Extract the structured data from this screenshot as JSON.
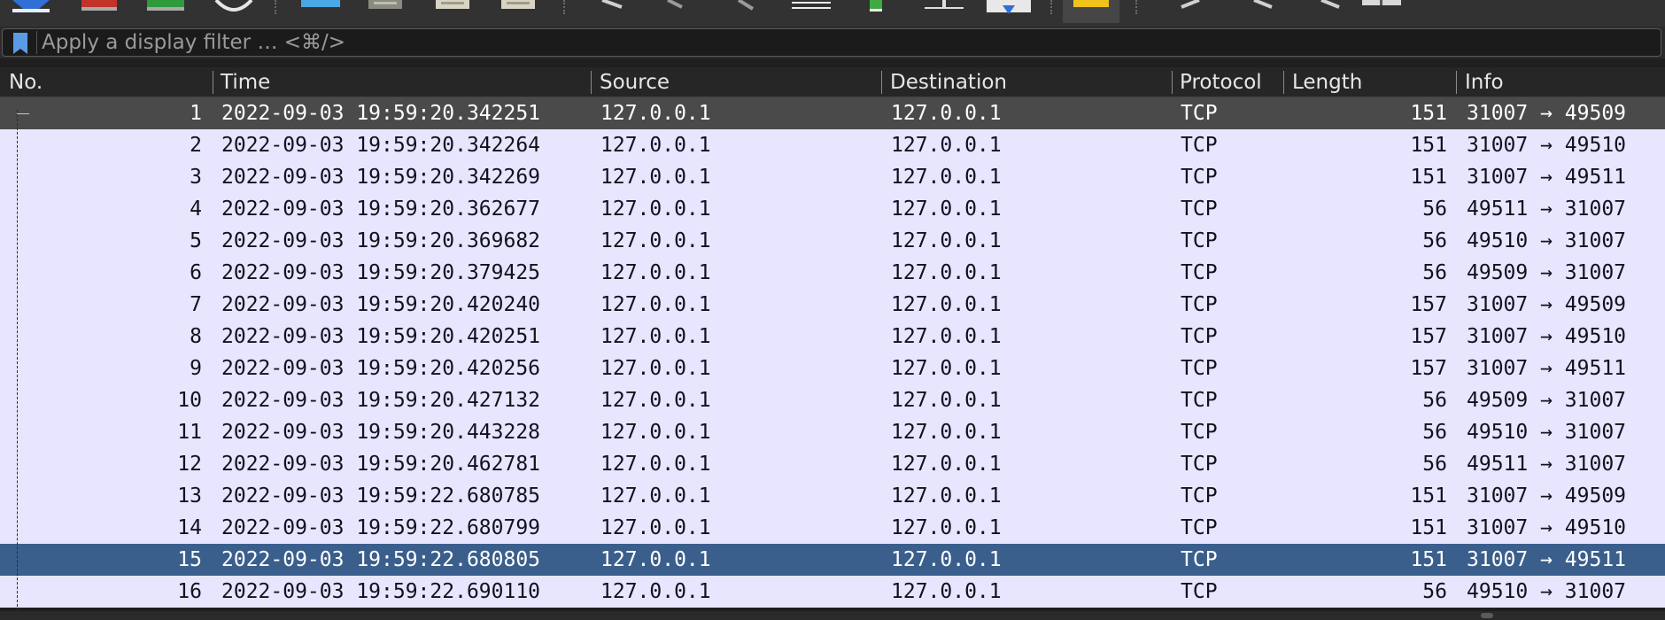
{
  "toolbar": {
    "icons": [
      "start-capture-icon",
      "stop-capture-icon",
      "restart-capture-icon",
      "capture-options-icon",
      "open-file-icon",
      "save-file-icon",
      "close-file-icon",
      "reload-file-icon",
      "find-packet-icon",
      "go-back-icon",
      "go-forward-icon",
      "go-to-packet-icon",
      "go-to-first-packet-icon",
      "go-to-last-packet-icon",
      "auto-scroll-icon",
      "colorize-icon",
      "zoom-in-icon",
      "zoom-out-icon",
      "normal-size-icon",
      "resize-columns-icon"
    ]
  },
  "filter": {
    "placeholder": "Apply a display filter … <⌘/>",
    "value": ""
  },
  "packet_list": {
    "columns": [
      "No.",
      "Time",
      "Source",
      "Destination",
      "Protocol",
      "Length",
      "Info"
    ],
    "rows": [
      {
        "no": "1",
        "time": "2022-09-03 19:59:20.342251",
        "source": "127.0.0.1",
        "destination": "127.0.0.1",
        "protocol": "TCP",
        "length": "151",
        "info": "31007 → 49509"
      },
      {
        "no": "2",
        "time": "2022-09-03 19:59:20.342264",
        "source": "127.0.0.1",
        "destination": "127.0.0.1",
        "protocol": "TCP",
        "length": "151",
        "info": "31007 → 49510"
      },
      {
        "no": "3",
        "time": "2022-09-03 19:59:20.342269",
        "source": "127.0.0.1",
        "destination": "127.0.0.1",
        "protocol": "TCP",
        "length": "151",
        "info": "31007 → 49511"
      },
      {
        "no": "4",
        "time": "2022-09-03 19:59:20.362677",
        "source": "127.0.0.1",
        "destination": "127.0.0.1",
        "protocol": "TCP",
        "length": "56",
        "info": "49511 → 31007"
      },
      {
        "no": "5",
        "time": "2022-09-03 19:59:20.369682",
        "source": "127.0.0.1",
        "destination": "127.0.0.1",
        "protocol": "TCP",
        "length": "56",
        "info": "49510 → 31007"
      },
      {
        "no": "6",
        "time": "2022-09-03 19:59:20.379425",
        "source": "127.0.0.1",
        "destination": "127.0.0.1",
        "protocol": "TCP",
        "length": "56",
        "info": "49509 → 31007"
      },
      {
        "no": "7",
        "time": "2022-09-03 19:59:20.420240",
        "source": "127.0.0.1",
        "destination": "127.0.0.1",
        "protocol": "TCP",
        "length": "157",
        "info": "31007 → 49509"
      },
      {
        "no": "8",
        "time": "2022-09-03 19:59:20.420251",
        "source": "127.0.0.1",
        "destination": "127.0.0.1",
        "protocol": "TCP",
        "length": "157",
        "info": "31007 → 49510"
      },
      {
        "no": "9",
        "time": "2022-09-03 19:59:20.420256",
        "source": "127.0.0.1",
        "destination": "127.0.0.1",
        "protocol": "TCP",
        "length": "157",
        "info": "31007 → 49511"
      },
      {
        "no": "10",
        "time": "2022-09-03 19:59:20.427132",
        "source": "127.0.0.1",
        "destination": "127.0.0.1",
        "protocol": "TCP",
        "length": "56",
        "info": "49509 → 31007"
      },
      {
        "no": "11",
        "time": "2022-09-03 19:59:20.443228",
        "source": "127.0.0.1",
        "destination": "127.0.0.1",
        "protocol": "TCP",
        "length": "56",
        "info": "49510 → 31007"
      },
      {
        "no": "12",
        "time": "2022-09-03 19:59:20.462781",
        "source": "127.0.0.1",
        "destination": "127.0.0.1",
        "protocol": "TCP",
        "length": "56",
        "info": "49511 → 31007"
      },
      {
        "no": "13",
        "time": "2022-09-03 19:59:22.680785",
        "source": "127.0.0.1",
        "destination": "127.0.0.1",
        "protocol": "TCP",
        "length": "151",
        "info": "31007 → 49509"
      },
      {
        "no": "14",
        "time": "2022-09-03 19:59:22.680799",
        "source": "127.0.0.1",
        "destination": "127.0.0.1",
        "protocol": "TCP",
        "length": "151",
        "info": "31007 → 49510"
      },
      {
        "no": "15",
        "time": "2022-09-03 19:59:22.680805",
        "source": "127.0.0.1",
        "destination": "127.0.0.1",
        "protocol": "TCP",
        "length": "151",
        "info": "31007 → 49511"
      },
      {
        "no": "16",
        "time": "2022-09-03 19:59:22.690110",
        "source": "127.0.0.1",
        "destination": "127.0.0.1",
        "protocol": "TCP",
        "length": "56",
        "info": "49510 → 31007"
      }
    ]
  },
  "colors": {
    "row_bg": "#e7e6fe",
    "row_text": "#12121e",
    "selected_row_bg": "#3b5f8c",
    "hover_row_bg": "#4a4a4a",
    "header_bg": "#262626",
    "toolbar_bg": "#323232"
  }
}
